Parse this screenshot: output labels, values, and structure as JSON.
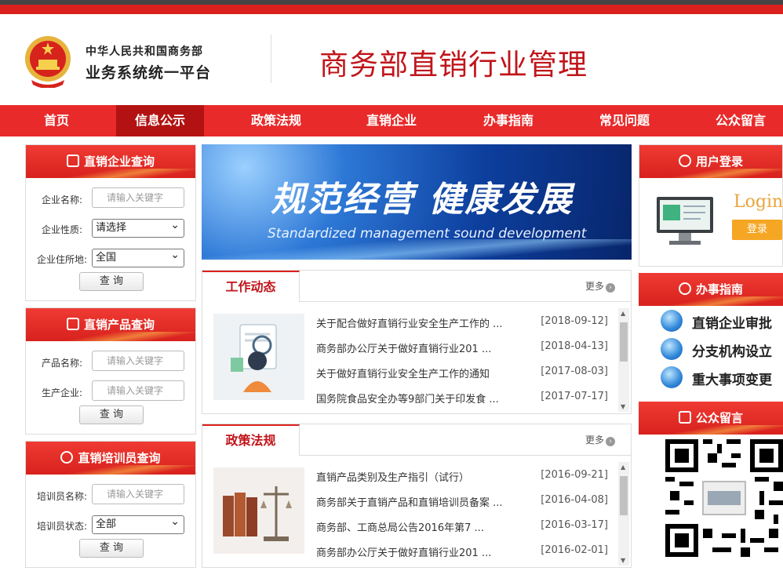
{
  "header": {
    "org_line1": "中华人民共和国商务部",
    "org_line2": "业务系统统一平台",
    "site_title": "商务部直销行业管理"
  },
  "nav": [
    "首页",
    "信息公示",
    "政策法规",
    "直销企业",
    "办事指南",
    "常见问题",
    "公众留言"
  ],
  "nav_active": 1,
  "company_query": {
    "title": "直销企业查询",
    "name_label": "企业名称:",
    "name_placeholder": "请输入关键字",
    "type_label": "企业性质:",
    "type_value": "请选择",
    "loc_label": "企业住所地:",
    "loc_value": "全国",
    "button": "查 询"
  },
  "product_query": {
    "title": "直销产品查询",
    "name_label": "产品名称:",
    "name_placeholder": "请输入关键字",
    "maker_label": "生产企业:",
    "maker_placeholder": "请输入关键字",
    "button": "查 询"
  },
  "trainer_query": {
    "title": "直销培训员查询",
    "name_label": "培训员名称:",
    "name_placeholder": "请输入关键字",
    "status_label": "培训员状态:",
    "status_value": "全部",
    "button": "查 询"
  },
  "banner": {
    "headline": "规范经营  健康发展",
    "subline": "Standardized management    sound development"
  },
  "work_news": {
    "title": "工作动态",
    "more": "更多",
    "items": [
      {
        "title": "关于配合做好直销行业安全生产工作的 ...",
        "date": "[2018-09-12]"
      },
      {
        "title": "商务部办公厅关于做好直销行业201 ...",
        "date": "[2018-04-13]"
      },
      {
        "title": "关于做好直销行业安全生产工作的通知",
        "date": "[2017-08-03]"
      },
      {
        "title": "国务院食品安全办等9部门关于印发食 ...",
        "date": "[2017-07-17]"
      }
    ]
  },
  "policy": {
    "title": "政策法规",
    "more": "更多",
    "items": [
      {
        "title": "直销产品类别及生产指引（试行）",
        "date": "[2016-09-21]"
      },
      {
        "title": "商务部关于直销产品和直销培训员备案 ...",
        "date": "[2016-04-08]"
      },
      {
        "title": "商务部、工商总局公告2016年第7 ...",
        "date": "[2016-03-17]"
      },
      {
        "title": "商务部办公厅关于做好直销行业201 ...",
        "date": "[2016-02-01]"
      }
    ]
  },
  "login": {
    "title": "用户登录",
    "word": "Login",
    "button": "登录"
  },
  "guide": {
    "title": "办事指南",
    "items": [
      "直销企业审批",
      "分支机构设立",
      "重大事项变更"
    ]
  },
  "message": {
    "title": "公众留言"
  },
  "colors": {
    "brand_red": "#d9201d",
    "nav_red": "#e92a2a",
    "nav_active": "#b31212",
    "title_red": "#c0151b",
    "login_orange": "#f5a623"
  }
}
